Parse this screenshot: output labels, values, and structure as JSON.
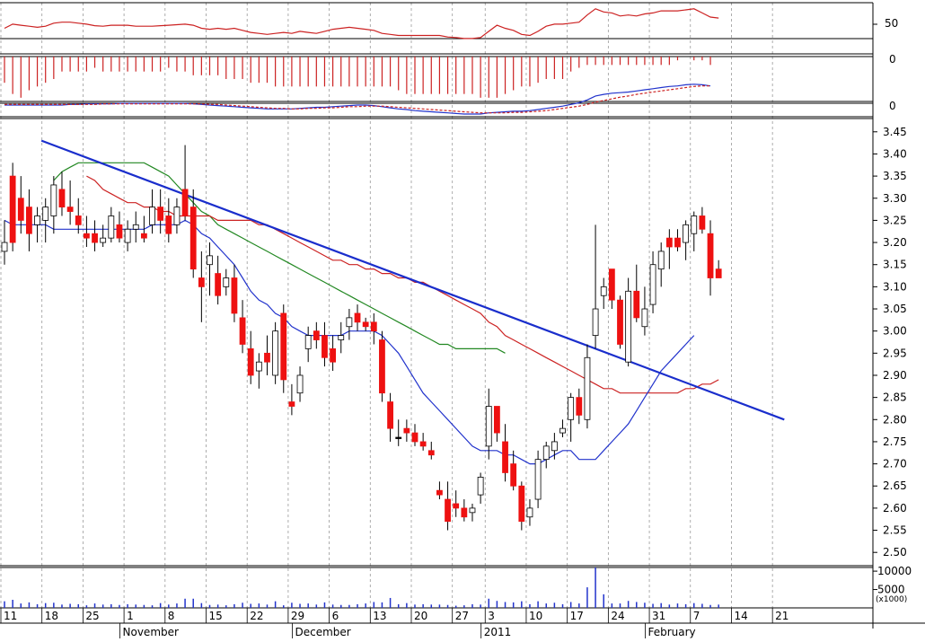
{
  "colors": {
    "up_candle": "#ffffff",
    "down_candle": "#ee1111",
    "flat_candle": "#000000",
    "ma_short": "#2233cc",
    "ma_mid": "#cc2222",
    "ma_long": "#228822",
    "trendline": "#1a2ecc",
    "rsi_line": "#cc2222",
    "macd_hist": "#cc2222",
    "macd_line": "#2233cc",
    "signal_line": "#cc2222",
    "volume": "#2233cc",
    "grid": "#999999"
  },
  "chart_data": {
    "type": "candlestick",
    "x_ticks": [
      {
        "i": 0,
        "label": "11"
      },
      {
        "i": 5,
        "label": "18"
      },
      {
        "i": 10,
        "label": "25"
      },
      {
        "i": 15,
        "label": "1"
      },
      {
        "i": 20,
        "label": "8"
      },
      {
        "i": 25,
        "label": "15"
      },
      {
        "i": 30,
        "label": "22"
      },
      {
        "i": 35,
        "label": "29"
      },
      {
        "i": 40,
        "label": "6"
      },
      {
        "i": 45,
        "label": "13"
      },
      {
        "i": 50,
        "label": "20"
      },
      {
        "i": 55,
        "label": "27"
      },
      {
        "i": 59,
        "label": "3"
      },
      {
        "i": 64,
        "label": "10"
      },
      {
        "i": 69,
        "label": "17"
      },
      {
        "i": 74,
        "label": "24"
      },
      {
        "i": 79,
        "label": "31"
      },
      {
        "i": 84,
        "label": "7"
      },
      {
        "i": 89,
        "label": "14"
      },
      {
        "i": 94,
        "label": "21"
      }
    ],
    "month_labels": [
      {
        "i": 14.5,
        "label": "November"
      },
      {
        "i": 35.5,
        "label": "December"
      },
      {
        "i": 58.5,
        "label": "2011"
      },
      {
        "i": 78.5,
        "label": "February"
      }
    ],
    "price_panel": {
      "ylim": [
        2.47,
        3.48
      ],
      "ticks": [
        2.5,
        2.55,
        2.6,
        2.65,
        2.7,
        2.75,
        2.8,
        2.85,
        2.9,
        2.95,
        3.0,
        3.05,
        3.1,
        3.15,
        3.2,
        3.25,
        3.3,
        3.35,
        3.4,
        3.45
      ],
      "candles": [
        [
          3.18,
          3.25,
          3.15,
          3.2
        ],
        [
          3.35,
          3.38,
          3.18,
          3.2
        ],
        [
          3.3,
          3.35,
          3.22,
          3.25
        ],
        [
          3.28,
          3.32,
          3.18,
          3.22
        ],
        [
          3.24,
          3.28,
          3.2,
          3.26
        ],
        [
          3.25,
          3.3,
          3.2,
          3.28
        ],
        [
          3.26,
          3.35,
          3.22,
          3.33
        ],
        [
          3.32,
          3.36,
          3.26,
          3.28
        ],
        [
          3.28,
          3.34,
          3.24,
          3.27
        ],
        [
          3.26,
          3.3,
          3.22,
          3.24
        ],
        [
          3.22,
          3.26,
          3.19,
          3.21
        ],
        [
          3.22,
          3.25,
          3.18,
          3.2
        ],
        [
          3.2,
          3.24,
          3.19,
          3.21
        ],
        [
          3.21,
          3.28,
          3.2,
          3.26
        ],
        [
          3.24,
          3.27,
          3.2,
          3.21
        ],
        [
          3.2,
          3.25,
          3.18,
          3.23
        ],
        [
          3.23,
          3.27,
          3.2,
          3.24
        ],
        [
          3.22,
          3.26,
          3.2,
          3.21
        ],
        [
          3.24,
          3.32,
          3.22,
          3.28
        ],
        [
          3.28,
          3.32,
          3.22,
          3.25
        ],
        [
          3.26,
          3.3,
          3.2,
          3.22
        ],
        [
          3.24,
          3.3,
          3.22,
          3.28
        ],
        [
          3.32,
          3.42,
          3.25,
          3.26
        ],
        [
          3.28,
          3.32,
          3.12,
          3.14
        ],
        [
          3.12,
          3.18,
          3.02,
          3.1
        ],
        [
          3.15,
          3.2,
          3.08,
          3.17
        ],
        [
          3.13,
          3.17,
          3.06,
          3.08
        ],
        [
          3.1,
          3.14,
          3.08,
          3.12
        ],
        [
          3.12,
          3.15,
          3.02,
          3.04
        ],
        [
          3.03,
          3.07,
          2.95,
          2.97
        ],
        [
          2.96,
          3.0,
          2.88,
          2.9
        ],
        [
          2.91,
          2.95,
          2.87,
          2.93
        ],
        [
          2.95,
          2.99,
          2.9,
          2.93
        ],
        [
          2.9,
          3.02,
          2.88,
          3.0
        ],
        [
          3.04,
          3.06,
          2.86,
          2.89
        ],
        [
          2.84,
          2.88,
          2.81,
          2.83
        ],
        [
          2.86,
          2.92,
          2.84,
          2.9
        ],
        [
          2.96,
          3.01,
          2.93,
          2.99
        ],
        [
          3.0,
          3.02,
          2.96,
          2.98
        ],
        [
          2.99,
          3.02,
          2.92,
          2.94
        ],
        [
          2.96,
          2.99,
          2.91,
          2.93
        ],
        [
          2.98,
          3.02,
          2.95,
          2.99
        ],
        [
          3.01,
          3.05,
          2.98,
          3.03
        ],
        [
          3.04,
          3.06,
          3.0,
          3.02
        ],
        [
          3.02,
          3.03,
          3.0,
          3.01
        ],
        [
          3.02,
          3.04,
          2.97,
          3.0
        ],
        [
          2.98,
          3.0,
          2.84,
          2.86
        ],
        [
          2.84,
          2.86,
          2.75,
          2.78
        ],
        [
          2.76,
          2.8,
          2.74,
          2.76
        ],
        [
          2.78,
          2.8,
          2.75,
          2.77
        ],
        [
          2.77,
          2.79,
          2.74,
          2.75
        ],
        [
          2.75,
          2.77,
          2.73,
          2.74
        ],
        [
          2.73,
          2.75,
          2.71,
          2.72
        ],
        [
          2.64,
          2.66,
          2.62,
          2.63
        ],
        [
          2.62,
          2.66,
          2.55,
          2.57
        ],
        [
          2.61,
          2.64,
          2.58,
          2.6
        ],
        [
          2.6,
          2.62,
          2.57,
          2.58
        ],
        [
          2.59,
          2.61,
          2.57,
          2.6
        ],
        [
          2.63,
          2.68,
          2.61,
          2.67
        ],
        [
          2.74,
          2.87,
          2.71,
          2.83
        ],
        [
          2.83,
          2.83,
          2.75,
          2.77
        ],
        [
          2.75,
          2.79,
          2.66,
          2.68
        ],
        [
          2.7,
          2.73,
          2.64,
          2.65
        ],
        [
          2.65,
          2.66,
          2.55,
          2.57
        ],
        [
          2.58,
          2.62,
          2.56,
          2.6
        ],
        [
          2.62,
          2.73,
          2.6,
          2.71
        ],
        [
          2.71,
          2.75,
          2.69,
          2.74
        ],
        [
          2.73,
          2.77,
          2.71,
          2.75
        ],
        [
          2.77,
          2.8,
          2.76,
          2.78
        ],
        [
          2.8,
          2.86,
          2.75,
          2.85
        ],
        [
          2.85,
          2.87,
          2.79,
          2.81
        ],
        [
          2.8,
          2.97,
          2.78,
          2.94
        ],
        [
          2.99,
          3.24,
          2.96,
          3.05
        ],
        [
          3.08,
          3.12,
          3.05,
          3.1
        ],
        [
          3.14,
          3.14,
          3.05,
          3.07
        ],
        [
          3.07,
          3.08,
          2.96,
          2.97
        ],
        [
          2.93,
          3.12,
          2.92,
          3.09
        ],
        [
          3.09,
          3.15,
          3.02,
          3.03
        ],
        [
          3.01,
          3.1,
          2.99,
          3.05
        ],
        [
          3.06,
          3.18,
          3.04,
          3.15
        ],
        [
          3.14,
          3.2,
          3.1,
          3.18
        ],
        [
          3.21,
          3.23,
          3.14,
          3.19
        ],
        [
          3.21,
          3.23,
          3.18,
          3.19
        ],
        [
          3.2,
          3.25,
          3.16,
          3.24
        ],
        [
          3.22,
          3.27,
          3.18,
          3.26
        ],
        [
          3.26,
          3.28,
          3.22,
          3.23
        ],
        [
          3.22,
          3.25,
          3.08,
          3.12
        ],
        [
          3.14,
          3.16,
          3.12,
          3.12
        ]
      ],
      "ma_short": [
        3.25,
        3.24,
        3.24,
        3.24,
        3.24,
        3.24,
        3.23,
        3.23,
        3.23,
        3.23,
        3.23,
        3.23,
        3.23,
        3.23,
        3.23,
        3.23,
        3.23,
        3.23,
        3.24,
        3.24,
        3.24,
        3.24,
        3.25,
        3.24,
        3.22,
        3.21,
        3.19,
        3.17,
        3.15,
        3.12,
        3.09,
        3.07,
        3.06,
        3.04,
        3.03,
        3.01,
        3.0,
        2.99,
        2.99,
        2.99,
        2.99,
        2.99,
        3.0,
        3.0,
        3.0,
        3.0,
        2.99,
        2.97,
        2.95,
        2.92,
        2.89,
        2.86,
        2.84,
        2.82,
        2.8,
        2.78,
        2.76,
        2.74,
        2.73,
        2.73,
        2.73,
        2.72,
        2.72,
        2.71,
        2.7,
        2.7,
        2.71,
        2.72,
        2.73,
        2.73,
        2.71,
        2.71,
        2.71,
        2.73,
        2.75,
        2.77,
        2.79,
        2.82,
        2.85,
        2.88,
        2.91,
        2.93,
        2.95,
        2.97,
        2.99
      ],
      "ma_mid": [
        3.35,
        3.34,
        3.32,
        3.31,
        3.3,
        3.29,
        3.29,
        3.28,
        3.28,
        3.27,
        3.27,
        3.26,
        3.26,
        3.26,
        3.26,
        3.26,
        3.25,
        3.25,
        3.25,
        3.25,
        3.25,
        3.24,
        3.24,
        3.23,
        3.22,
        3.21,
        3.2,
        3.19,
        3.18,
        3.17,
        3.16,
        3.16,
        3.15,
        3.15,
        3.14,
        3.14,
        3.13,
        3.13,
        3.12,
        3.12,
        3.11,
        3.11,
        3.1,
        3.09,
        3.08,
        3.07,
        3.06,
        3.05,
        3.04,
        3.02,
        3.01,
        2.99,
        2.98,
        2.97,
        2.96,
        2.95,
        2.94,
        2.93,
        2.92,
        2.91,
        2.9,
        2.89,
        2.88,
        2.87,
        2.87,
        2.86,
        2.86,
        2.86,
        2.86,
        2.86,
        2.86,
        2.86,
        2.86,
        2.87,
        2.87,
        2.88,
        2.88,
        2.89
      ],
      "ma_mid_start": 10,
      "ma_long": [
        3.34,
        3.36,
        3.37,
        3.38,
        3.38,
        3.38,
        3.38,
        3.38,
        3.38,
        3.38,
        3.38,
        3.38,
        3.37,
        3.36,
        3.35,
        3.33,
        3.31,
        3.29,
        3.27,
        3.26,
        3.24,
        3.23,
        3.22,
        3.21,
        3.2,
        3.19,
        3.18,
        3.17,
        3.16,
        3.15,
        3.14,
        3.13,
        3.12,
        3.11,
        3.1,
        3.09,
        3.08,
        3.07,
        3.06,
        3.05,
        3.04,
        3.03,
        3.02,
        3.01,
        3.0,
        2.99,
        2.98,
        2.97,
        2.97,
        2.96,
        2.96,
        2.96,
        2.96,
        2.96,
        2.96,
        2.95
      ],
      "ma_long_start": 6,
      "trendline": [
        [
          4.5,
          3.43
        ],
        [
          95,
          2.8
        ]
      ]
    },
    "volume_panel": {
      "ylim": [
        0,
        11000
      ],
      "ticks": [
        5000,
        10000
      ],
      "unit_label": "(x1000)",
      "values": [
        1800,
        2200,
        1200,
        1500,
        1000,
        1300,
        1400,
        900,
        1100,
        1000,
        700,
        1200,
        900,
        1000,
        800,
        1000,
        900,
        800,
        700,
        1300,
        900,
        1200,
        2500,
        2500,
        1300,
        800,
        900,
        700,
        1000,
        1400,
        1100,
        1200,
        900,
        1800,
        700,
        1400,
        1100,
        1200,
        900,
        1500,
        900,
        800,
        800,
        1000,
        1200,
        1600,
        1500,
        2700,
        1000,
        1300,
        900,
        1000,
        900,
        900,
        800,
        600,
        700,
        1000,
        900,
        2500,
        1900,
        1600,
        1500,
        1800,
        1000,
        1800,
        1200,
        1400,
        1000,
        1600,
        1200,
        5600,
        11500,
        3700,
        1200,
        1200,
        1900,
        1600,
        1400,
        1100,
        1300,
        900,
        1200,
        1000,
        1300,
        1100,
        800,
        900
      ]
    },
    "macd_panel": {
      "zero_label": "0",
      "line": [
        -0.06,
        -0.06,
        -0.06,
        -0.06,
        -0.06,
        -0.06,
        -0.06,
        -0.06,
        -0.05,
        -0.05,
        -0.04,
        -0.04,
        -0.04,
        -0.04,
        -0.03,
        -0.03,
        -0.03,
        -0.03,
        -0.03,
        -0.03,
        -0.03,
        -0.03,
        -0.03,
        -0.04,
        -0.05,
        -0.06,
        -0.07,
        -0.08,
        -0.09,
        -0.1,
        -0.11,
        -0.12,
        -0.13,
        -0.13,
        -0.13,
        -0.13,
        -0.12,
        -0.11,
        -0.1,
        -0.1,
        -0.09,
        -0.08,
        -0.07,
        -0.06,
        -0.06,
        -0.07,
        -0.09,
        -0.11,
        -0.13,
        -0.14,
        -0.16,
        -0.17,
        -0.18,
        -0.19,
        -0.2,
        -0.21,
        -0.22,
        -0.22,
        -0.22,
        -0.2,
        -0.19,
        -0.18,
        -0.17,
        -0.17,
        -0.16,
        -0.14,
        -0.12,
        -0.1,
        -0.08,
        -0.05,
        -0.02,
        0.03,
        0.1,
        0.13,
        0.15,
        0.16,
        0.17,
        0.19,
        0.21,
        0.23,
        0.25,
        0.27,
        0.28,
        0.3,
        0.31,
        0.3,
        0.28
      ],
      "signal": [
        -0.05,
        -0.05,
        -0.05,
        -0.05,
        -0.05,
        -0.05,
        -0.05,
        -0.05,
        -0.05,
        -0.05,
        -0.05,
        -0.05,
        -0.04,
        -0.04,
        -0.04,
        -0.04,
        -0.04,
        -0.04,
        -0.04,
        -0.04,
        -0.04,
        -0.04,
        -0.04,
        -0.04,
        -0.04,
        -0.05,
        -0.05,
        -0.06,
        -0.07,
        -0.08,
        -0.09,
        -0.1,
        -0.11,
        -0.12,
        -0.12,
        -0.13,
        -0.13,
        -0.12,
        -0.12,
        -0.11,
        -0.11,
        -0.1,
        -0.09,
        -0.09,
        -0.08,
        -0.08,
        -0.08,
        -0.09,
        -0.1,
        -0.11,
        -0.12,
        -0.13,
        -0.14,
        -0.15,
        -0.16,
        -0.17,
        -0.18,
        -0.19,
        -0.2,
        -0.2,
        -0.2,
        -0.2,
        -0.19,
        -0.19,
        -0.18,
        -0.17,
        -0.16,
        -0.14,
        -0.12,
        -0.1,
        -0.08,
        -0.05,
        -0.01,
        0.02,
        0.05,
        0.08,
        0.1,
        0.13,
        0.15,
        0.17,
        0.19,
        0.21,
        0.23,
        0.25,
        0.27,
        0.28,
        0.28
      ],
      "ylim": [
        -0.3,
        0.45
      ]
    },
    "momentum_panel": {
      "zero_label": "0",
      "ylim": [
        -1,
        0.2
      ],
      "hist": [
        -0.5,
        -0.8,
        -0.9,
        -0.7,
        -0.6,
        -0.5,
        -0.4,
        -0.2,
        -0.2,
        -0.2,
        -0.2,
        -0.1,
        -0.2,
        -0.2,
        -0.2,
        -0.2,
        -0.2,
        -0.2,
        -0.2,
        -0.2,
        -0.1,
        -0.2,
        -0.2,
        -0.3,
        -0.3,
        -0.3,
        -0.3,
        -0.4,
        -0.4,
        -0.4,
        -0.5,
        -0.5,
        -0.5,
        -0.6,
        -0.6,
        -0.6,
        -0.6,
        -0.6,
        -0.6,
        -0.6,
        -0.6,
        -0.6,
        -0.6,
        -0.6,
        -0.6,
        -0.6,
        -0.6,
        -0.6,
        -0.7,
        -0.8,
        -0.8,
        -0.8,
        -0.8,
        -0.8,
        -0.8,
        -0.8,
        -0.8,
        -0.8,
        -0.9,
        -0.9,
        -0.9,
        -0.8,
        -0.7,
        -0.6,
        -0.6,
        -0.5,
        -0.4,
        -0.4,
        -0.4,
        -0.2,
        -0.1,
        0,
        0,
        0,
        0,
        0,
        0,
        0,
        0,
        0,
        0,
        0,
        0.1,
        0.2,
        0.1,
        0.1,
        0
      ]
    },
    "rsi_panel": {
      "tick": 50,
      "tick_label": "50",
      "ylim": [
        0,
        100
      ],
      "line": [
        50,
        58,
        56,
        54,
        52,
        54,
        60,
        62,
        62,
        60,
        58,
        55,
        54,
        56,
        56,
        56,
        54,
        54,
        54,
        55,
        56,
        57,
        58,
        56,
        50,
        48,
        50,
        48,
        50,
        46,
        42,
        40,
        38,
        40,
        42,
        40,
        44,
        42,
        40,
        44,
        48,
        50,
        52,
        50,
        48,
        46,
        40,
        38,
        36,
        36,
        36,
        36,
        36,
        36,
        33,
        32,
        30,
        30,
        32,
        44,
        56,
        50,
        46,
        38,
        36,
        44,
        54,
        58,
        58,
        60,
        62,
        76,
        88,
        82,
        80,
        74,
        76,
        74,
        78,
        80,
        84,
        84,
        84,
        86,
        88,
        80,
        72,
        70
      ]
    }
  }
}
